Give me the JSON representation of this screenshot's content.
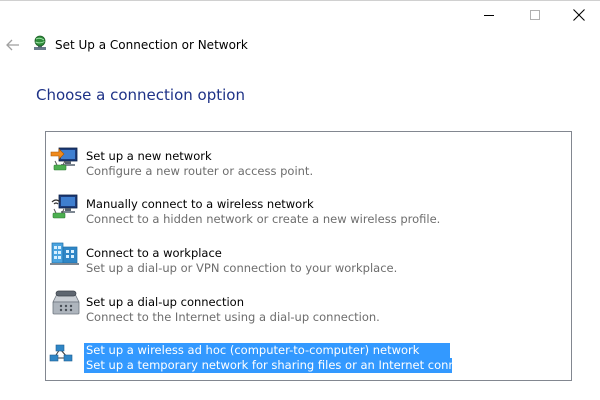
{
  "window": {
    "title": "Set Up a Connection or Network",
    "controls": [
      "minimize-icon",
      "maximize-icon",
      "close-icon"
    ]
  },
  "page": {
    "heading": "Choose a connection option"
  },
  "options": [
    {
      "title": "Set up a new network",
      "description": "Configure a new router or access point.",
      "icon": "new-network-icon",
      "selected": false
    },
    {
      "title": "Manually connect to a wireless network",
      "description": "Connect to a hidden network or create a new wireless profile.",
      "icon": "wireless-network-icon",
      "selected": false
    },
    {
      "title": "Connect to a workplace",
      "description": "Set up a dial-up or VPN connection to your workplace.",
      "icon": "workplace-icon",
      "selected": false
    },
    {
      "title": "Set up a dial-up connection",
      "description": "Connect to the Internet using a dial-up connection.",
      "icon": "dialup-phone-icon",
      "selected": false
    },
    {
      "title": "Set up a wireless ad hoc (computer-to-computer) network",
      "description": "Set up a temporary network for sharing files or an Internet connection.",
      "icon": "adhoc-network-icon",
      "selected": true
    }
  ],
  "colors": {
    "heading": "#1e3287",
    "selection": "#3399ff",
    "description": "#6d6d6d"
  }
}
